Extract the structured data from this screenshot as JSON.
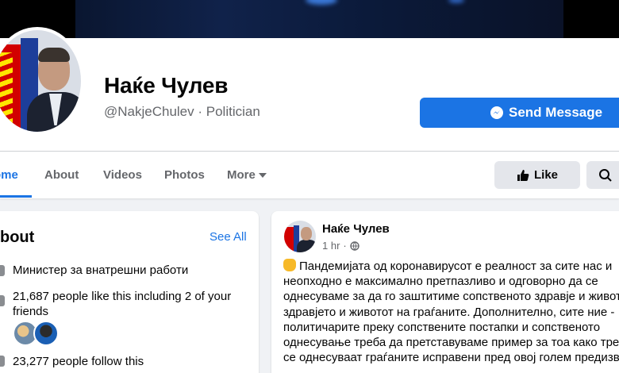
{
  "page": {
    "name": "Наќе Чулев",
    "handle": "@NakjeChulev",
    "category": "Politician",
    "send_message_label": "Send Message"
  },
  "tabs": [
    {
      "label": "ome",
      "active": true
    },
    {
      "label": "About"
    },
    {
      "label": "Videos"
    },
    {
      "label": "Photos"
    },
    {
      "label": "More"
    }
  ],
  "actions": {
    "like_label": "Like"
  },
  "about": {
    "title": "bout",
    "see_all": "See All",
    "items": [
      "Министер за внатрешни работи",
      "21,687 people like this including 2 of your friends",
      "23,277 people follow this"
    ]
  },
  "post": {
    "author": "Наќе Чулев",
    "time": "1 hr",
    "lines": [
      "Пандемијата од коронавирусот е реалност за сите нас и",
      "неопходно е максимално претпазливо и одговорно да се",
      "однесуваме за да го заштитиме сопственото здравје и животот,",
      "здравјето и животот на граѓаните. Дополнително, сите ние -",
      "политичарите преку сопствените постапки и сопственото",
      "однесување треба да претставуваме пример за тоа како треба да",
      "се однесуваат граѓаните исправени пред овој голем предизвик."
    ]
  },
  "colors": {
    "accent": "#1b74e4",
    "background": "#f0f2f5",
    "secondary_text": "#65676b"
  }
}
